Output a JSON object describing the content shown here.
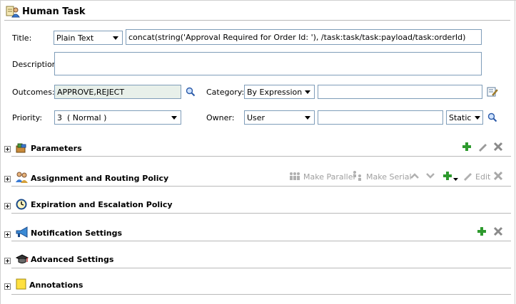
{
  "window": {
    "title": "Human Task"
  },
  "form": {
    "title_label": "Title:",
    "title_mode": "Plain Text",
    "title_value": "concat(string('Approval Required for Order Id: '), /task:task/task:payload/task:orderId)",
    "description_label": "Description:",
    "description_value": "",
    "outcomes_label": "Outcomes:",
    "outcomes_value": "APPROVE,REJECT",
    "category_label": "Category:",
    "category_mode": "By Expression",
    "category_value": "",
    "priority_label": "Priority:",
    "priority_value": "3  ( Normal )",
    "owner_label": "Owner:",
    "owner_type": "User",
    "owner_value": "",
    "owner_mode": "Static"
  },
  "sections": {
    "parameters": "Parameters",
    "assignment": "Assignment and Routing Policy",
    "expiration": "Expiration and Escalation Policy",
    "notification": "Notification Settings",
    "advanced": "Advanced Settings",
    "annotations": "Annotations"
  },
  "assignment_toolbar": {
    "make_parallel": "Make Parallel",
    "make_serial": "Make Serial",
    "edit": "Edit"
  },
  "colors": {
    "add": "#2e9a2e",
    "disabled": "#a0a0a0",
    "accent": "#316ac5"
  }
}
